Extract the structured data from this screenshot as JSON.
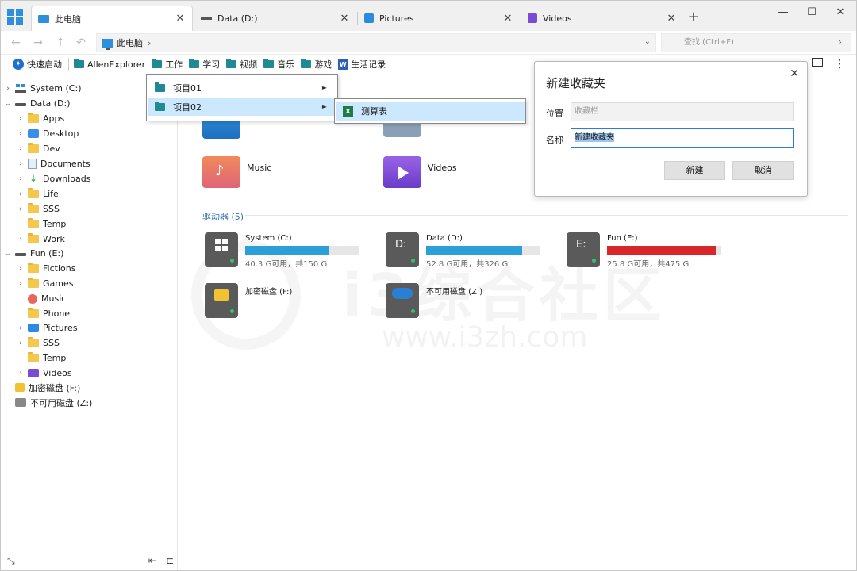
{
  "tabs": [
    {
      "label": "此电脑",
      "icon": "computer-icon",
      "active": true
    },
    {
      "label": "Data (D:)",
      "icon": "drive-icon",
      "active": false
    },
    {
      "label": "Pictures",
      "icon": "pictures-icon",
      "active": false
    },
    {
      "label": "Videos",
      "icon": "videos-icon",
      "active": false
    }
  ],
  "address": {
    "path": "此电脑"
  },
  "search": {
    "placeholder": "查找 (Ctrl+F)"
  },
  "bookmarks": {
    "quick_access": "快速启动",
    "items": [
      "AllenExplorer",
      "工作",
      "学习",
      "视频",
      "音乐",
      "游戏",
      "生活记录"
    ]
  },
  "tree": [
    {
      "label": "System (C:)",
      "icon": "system-drive-icon",
      "level": 0,
      "expanded": false
    },
    {
      "label": "Data (D:)",
      "icon": "drive-icon",
      "level": 0,
      "expanded": true
    },
    {
      "label": "Apps",
      "icon": "folder-icon",
      "level": 1
    },
    {
      "label": "Desktop",
      "icon": "desktop-icon",
      "level": 1
    },
    {
      "label": "Dev",
      "icon": "folder-icon",
      "level": 1
    },
    {
      "label": "Documents",
      "icon": "documents-icon",
      "level": 1
    },
    {
      "label": "Downloads",
      "icon": "downloads-icon",
      "level": 1
    },
    {
      "label": "Life",
      "icon": "folder-icon",
      "level": 1
    },
    {
      "label": "SSS",
      "icon": "folder-icon",
      "level": 1
    },
    {
      "label": "Temp",
      "icon": "folder-icon",
      "level": 1
    },
    {
      "label": "Work",
      "icon": "folder-icon",
      "level": 1
    },
    {
      "label": "Fun (E:)",
      "icon": "drive-icon",
      "level": 0,
      "expanded": true
    },
    {
      "label": "Fictions",
      "icon": "folder-icon",
      "level": 1
    },
    {
      "label": "Games",
      "icon": "folder-icon",
      "level": 1
    },
    {
      "label": "Music",
      "icon": "music-icon",
      "level": 1
    },
    {
      "label": "Phone",
      "icon": "folder-icon",
      "level": 1
    },
    {
      "label": "Pictures",
      "icon": "pictures-icon",
      "level": 1
    },
    {
      "label": "SSS",
      "icon": "folder-icon",
      "level": 1
    },
    {
      "label": "Temp",
      "icon": "folder-icon",
      "level": 1
    },
    {
      "label": "Videos",
      "icon": "videos-icon",
      "level": 1
    },
    {
      "label": "加密磁盘 (F:)",
      "icon": "lock-drive-icon",
      "level": 0
    },
    {
      "label": "不可用磁盘 (Z:)",
      "icon": "unavailable-drive-icon",
      "level": 0
    }
  ],
  "folders": [
    {
      "label": "Music",
      "icon": "music-folder-icon"
    },
    {
      "label": "Videos",
      "icon": "videos-folder-icon"
    }
  ],
  "drives_section": {
    "title": "驱动器 (5)"
  },
  "drives": [
    {
      "name": "System (C:)",
      "info": "40.3 G可用，共150 G",
      "used_fraction": 0.73,
      "color": "#2a9fd8"
    },
    {
      "name": "Data (D:)",
      "info": "52.8 G可用，共326 G",
      "used_fraction": 0.84,
      "color": "#2a9fd8"
    },
    {
      "name": "Fun (E:)",
      "info": "25.8 G可用，共475 G",
      "used_fraction": 0.95,
      "color": "#d9262b"
    },
    {
      "name": "加密磁盘 (F:)",
      "info": ""
    },
    {
      "name": "不可用磁盘 (Z:)",
      "info": ""
    }
  ],
  "drive_letters": {
    "d": "D:",
    "e": "E:"
  },
  "menu": {
    "items": [
      "项目01",
      "项目02"
    ],
    "submenu_item": "测算表"
  },
  "dialog": {
    "title": "新建收藏夹",
    "location_label": "位置",
    "location_value": "收藏栏",
    "name_label": "名称",
    "name_value": "新建收藏夹",
    "ok_label": "新建",
    "cancel_label": "取消"
  },
  "watermark": {
    "text": "i3综合社区",
    "url": "www.i3zh.com"
  },
  "colors": {
    "accent": "#2f8fdd",
    "menu_highlight": "#cce8ff",
    "full_drive": "#d9262b"
  }
}
